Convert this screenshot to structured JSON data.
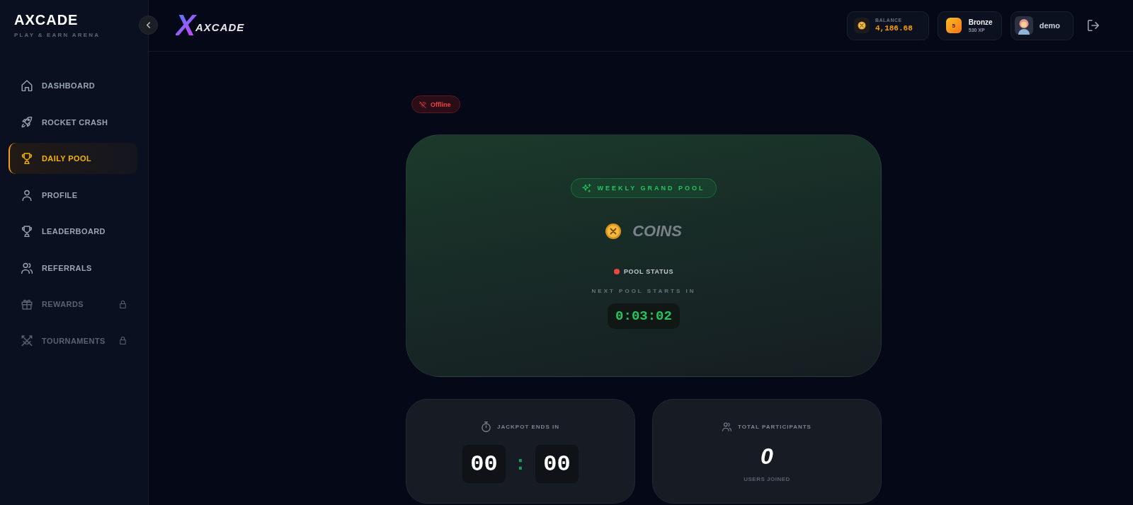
{
  "sidebar": {
    "brand": "AXCADE",
    "tagline": "PLAY & EARN ARENA",
    "items": [
      {
        "label": "DASHBOARD",
        "selected": false,
        "locked": false
      },
      {
        "label": "ROCKET CRASH",
        "selected": false,
        "locked": false
      },
      {
        "label": "DAILY POOL",
        "selected": true,
        "locked": false
      },
      {
        "label": "PROFILE",
        "selected": false,
        "locked": false
      },
      {
        "label": "LEADERBOARD",
        "selected": false,
        "locked": false
      },
      {
        "label": "REFERRALS",
        "selected": false,
        "locked": false
      },
      {
        "label": "REWARDS",
        "selected": false,
        "locked": true
      },
      {
        "label": "TOURNAMENTS",
        "selected": false,
        "locked": true
      }
    ]
  },
  "header": {
    "logo": {
      "mark": "X",
      "wordmark": "AXCADE"
    },
    "balance": {
      "label": "BALANCE",
      "value": "4,186.68"
    },
    "rank": {
      "badge": "5",
      "name": "Bronze",
      "xp": "530 XP"
    },
    "user": {
      "name": "demo"
    }
  },
  "connection": {
    "label": "Offline",
    "online": false
  },
  "pool": {
    "tag": "WEEKLY GRAND POOL",
    "currency": "COINS",
    "status_label": "POOL STATUS",
    "active": false,
    "countdown_label": "NEXT POOL STARTS IN",
    "countdown": "0:03:02"
  },
  "stats": {
    "jackpot": {
      "label": "JACKPOT ENDS IN",
      "minutes": "00",
      "separator": ":",
      "seconds": "00"
    },
    "participants": {
      "label": "TOTAL PARTICIPANTS",
      "count": "0",
      "caption": "USERS JOINED"
    }
  }
}
